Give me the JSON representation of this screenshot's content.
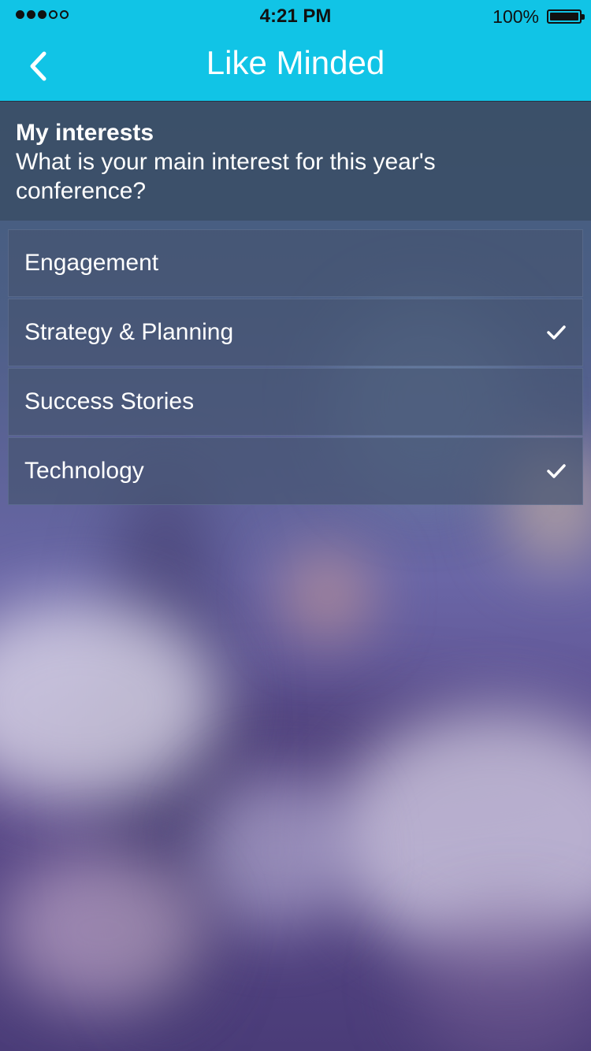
{
  "status_bar": {
    "time": "4:21 PM",
    "battery": "100%",
    "signal_bars": 3,
    "signal_total": 5
  },
  "nav": {
    "title": "Like Minded",
    "back_icon": "chevron-left-icon"
  },
  "header": {
    "title": "My interests",
    "question": "What is your main interest for this year's conference?"
  },
  "interests": [
    {
      "label": "Engagement",
      "checked": false
    },
    {
      "label": "Strategy & Planning",
      "checked": true
    },
    {
      "label": "Success Stories",
      "checked": false
    },
    {
      "label": "Technology",
      "checked": true
    }
  ],
  "colors": {
    "accent": "#11c4e6",
    "text": "#ffffff"
  }
}
